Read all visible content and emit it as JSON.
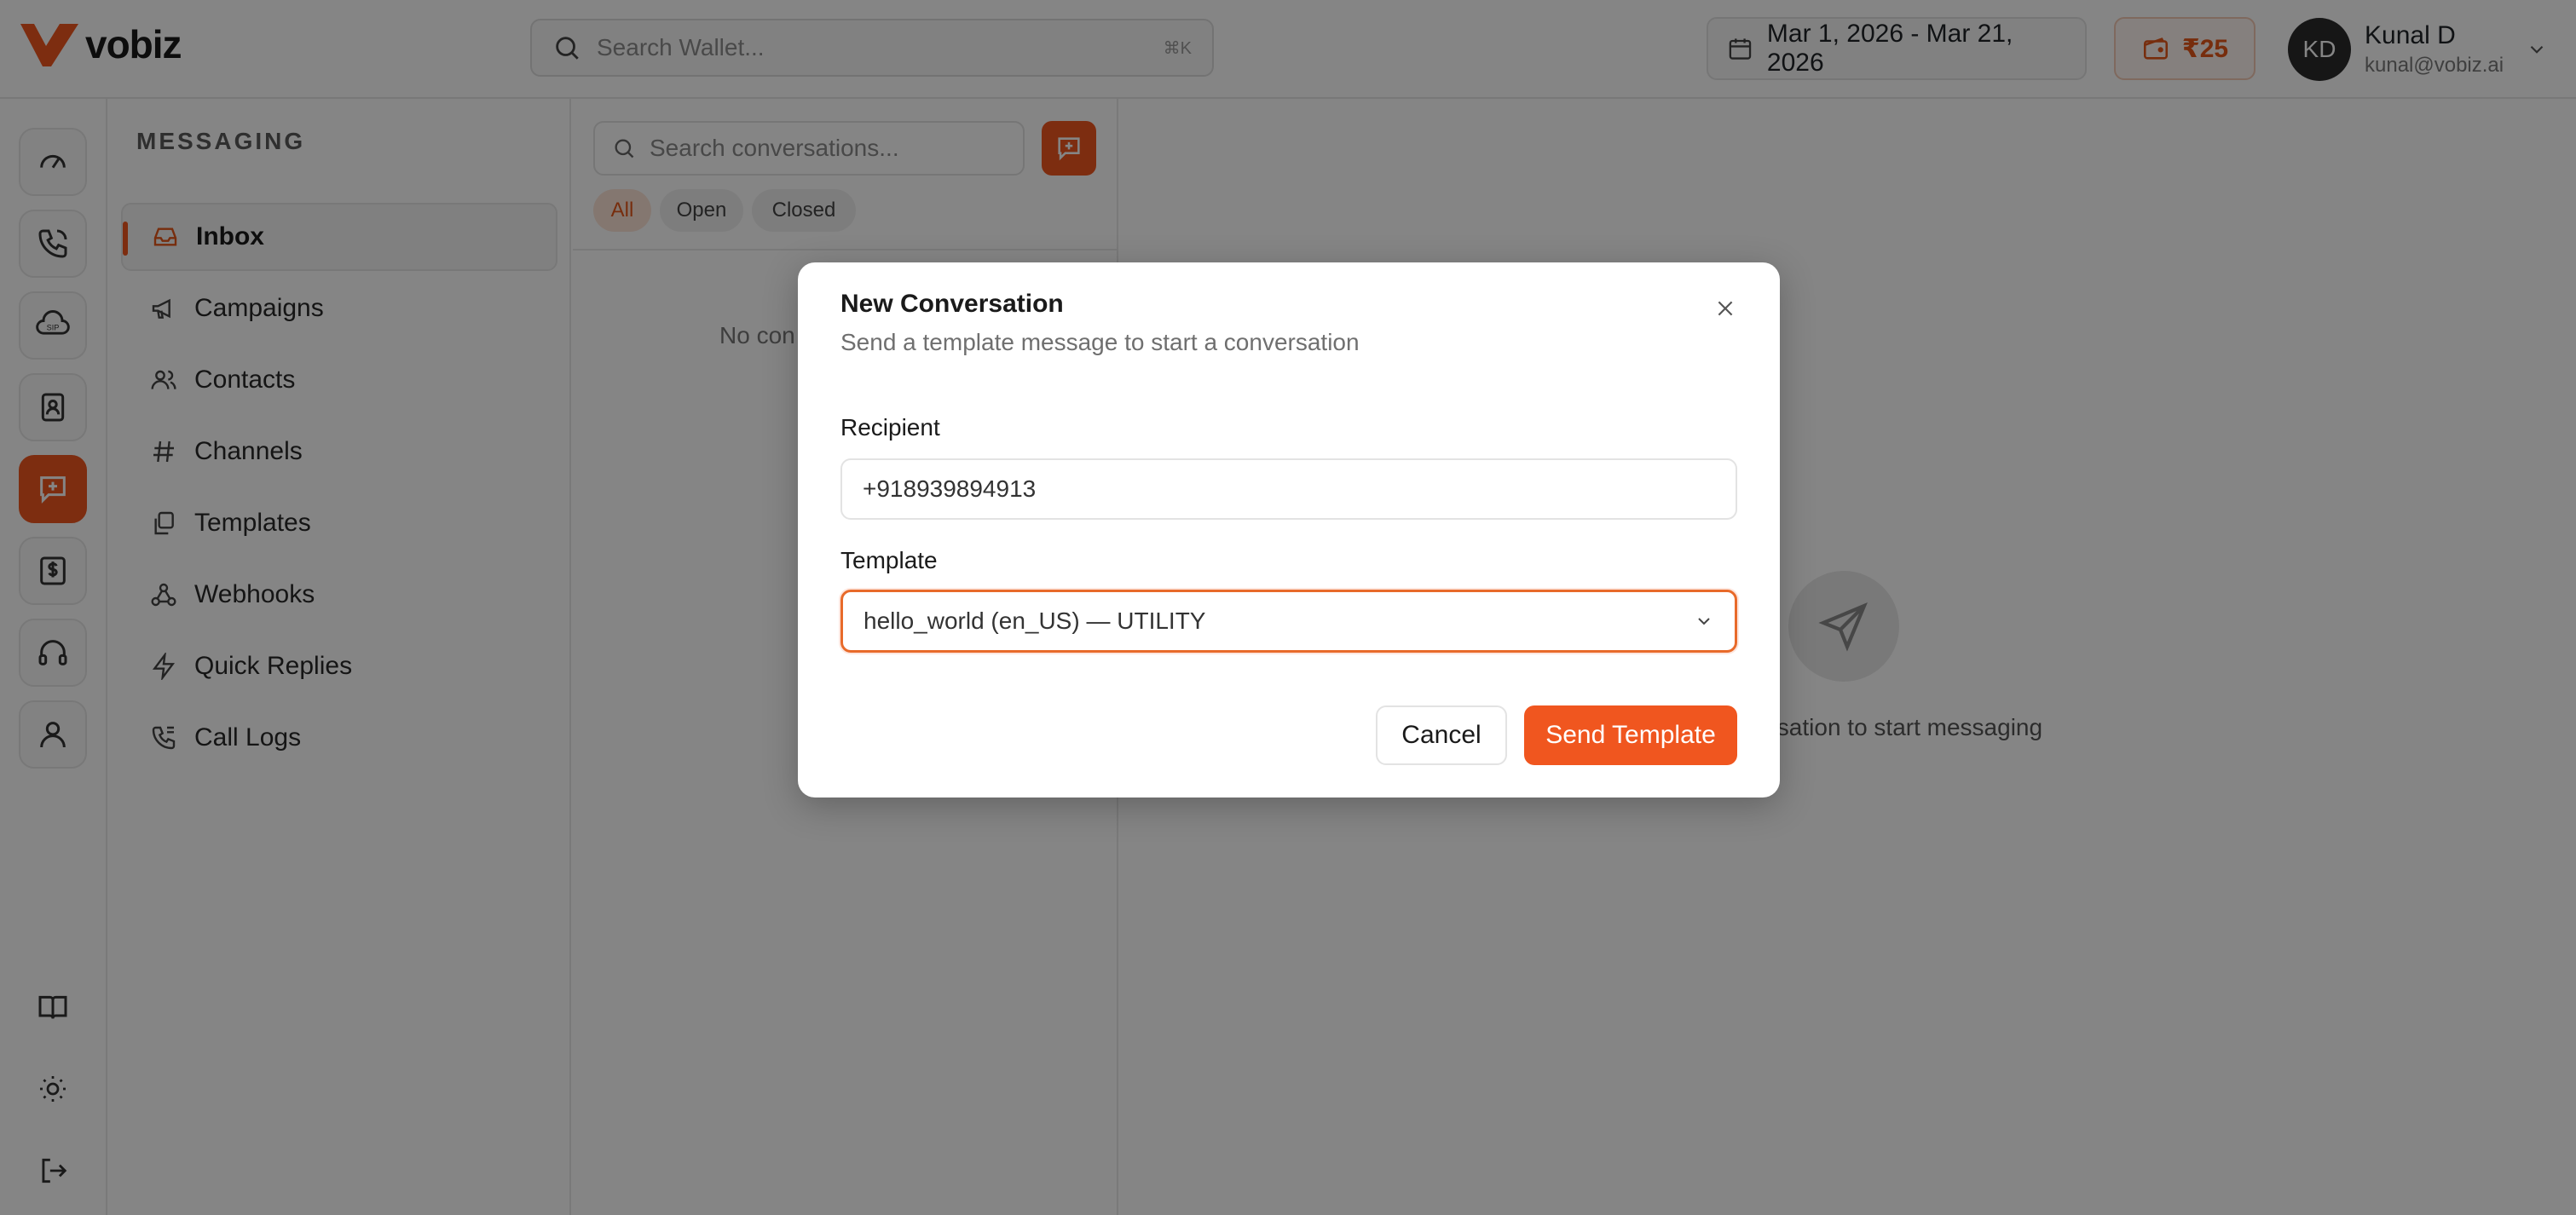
{
  "brand": {
    "name": "vobiz",
    "accent": "#f0561f"
  },
  "topbar": {
    "search_placeholder": "Search Wallet...",
    "search_shortcut": "⌘K",
    "date_range": "Mar 1, 2026 - Mar 21, 2026",
    "wallet_amount": "₹25",
    "user": {
      "initials": "KD",
      "name": "Kunal D",
      "email": "kunal@vobiz.ai"
    }
  },
  "rail": {
    "items": [
      "dashboard-icon",
      "phone-icon",
      "sip-cloud-icon",
      "contacts-book-icon",
      "messaging-icon",
      "billing-icon",
      "support-headset-icon",
      "profile-icon"
    ],
    "bottom": [
      "docs-book-icon",
      "theme-sun-icon",
      "logout-icon"
    ],
    "active": "messaging-icon"
  },
  "subnav": {
    "title": "MESSAGING",
    "items": [
      {
        "label": "Inbox",
        "icon": "inbox-icon",
        "active": true
      },
      {
        "label": "Campaigns",
        "icon": "megaphone-icon"
      },
      {
        "label": "Contacts",
        "icon": "users-icon"
      },
      {
        "label": "Channels",
        "icon": "hash-icon"
      },
      {
        "label": "Templates",
        "icon": "copy-icon"
      },
      {
        "label": "Webhooks",
        "icon": "webhook-icon"
      },
      {
        "label": "Quick Replies",
        "icon": "bolt-icon"
      },
      {
        "label": "Call Logs",
        "icon": "call-log-icon"
      }
    ]
  },
  "conversations": {
    "search_placeholder": "Search conversations...",
    "filters": [
      "All",
      "Open",
      "Closed"
    ],
    "active_filter": "All",
    "empty_text": "No con"
  },
  "main": {
    "empty_text": "ersation to start messaging"
  },
  "modal": {
    "title": "New Conversation",
    "subtitle": "Send a template message to start a conversation",
    "recipient_label": "Recipient",
    "recipient_value": "+918939894913",
    "template_label": "Template",
    "template_value": "hello_world (en_US) — UTILITY",
    "cancel_label": "Cancel",
    "send_label": "Send Template"
  }
}
